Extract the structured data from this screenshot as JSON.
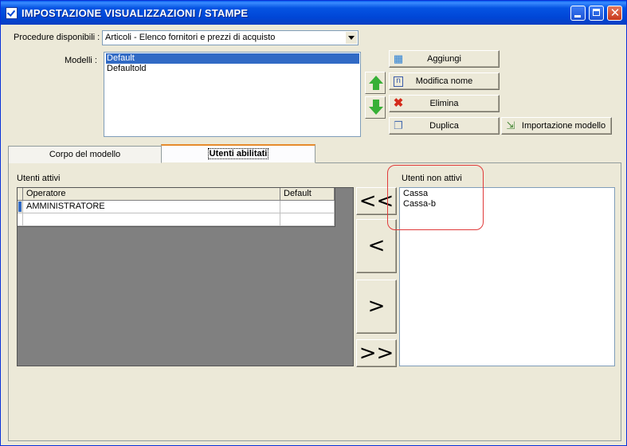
{
  "window": {
    "title": "IMPOSTAZIONE VISUALIZZAZIONI / STAMPE"
  },
  "procedure": {
    "label": "Procedure disponibili :",
    "selected": "Articoli - Elenco fornitori e prezzi di acquisto"
  },
  "modelli": {
    "label": "Modelli :",
    "items": [
      "Default",
      "Defaultold"
    ],
    "selected_index": 0
  },
  "buttons": {
    "aggiungi": "Aggiungi",
    "modifica_nome": "Modifica nome",
    "elimina": "Elimina",
    "duplica": "Duplica",
    "importazione_modello": "Importazione modello"
  },
  "tabs": [
    {
      "label": "Corpo del modello",
      "active": false
    },
    {
      "label": "Utenti abilitati",
      "active": true
    }
  ],
  "utenti_attivi": {
    "label": "Utenti attivi",
    "columns": [
      "Operatore",
      "Default"
    ],
    "rows": [
      {
        "operatore": "AMMINISTRATORE",
        "default": ""
      }
    ]
  },
  "move_buttons": {
    "all_left": "<<",
    "left": "<",
    "right": ">",
    "all_right": ">>"
  },
  "utenti_non_attivi": {
    "label": "Utenti non attivi",
    "items": [
      "Cassa",
      "Cassa-b"
    ]
  },
  "colors": {
    "title_bar": "#0046d6",
    "selection": "#316ac5",
    "active_tab_accent": "#e68b2c",
    "annotation": "#e03a3a"
  }
}
